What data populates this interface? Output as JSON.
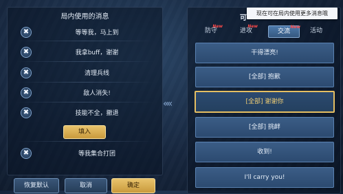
{
  "left_panel": {
    "title": "局内使用的消息",
    "messages": [
      {
        "label": "等等我，马上到",
        "remove_icon": "close-icon"
      },
      {
        "label": "我拿buff，谢谢",
        "remove_icon": "close-icon"
      },
      {
        "label": "清理兵线",
        "remove_icon": "close-icon"
      },
      {
        "label": "敌人消失!",
        "remove_icon": "close-icon"
      },
      {
        "label": "技能不全，撤退",
        "remove_icon": "close-icon"
      },
      {
        "label": "等我集合打团",
        "remove_icon": "close-icon"
      }
    ],
    "fill_button": "填入",
    "remove_glyph": "✖"
  },
  "transfer_arrows": "«",
  "bottom_buttons": {
    "restore_default": "恢复默认",
    "cancel": "取消",
    "confirm": "确定"
  },
  "right_panel": {
    "title_partial": "可",
    "tooltip": "现在可在局内使用更多消息哦",
    "tabs": [
      {
        "label": "防守",
        "new": "New",
        "active": false
      },
      {
        "label": "进攻",
        "new": "New",
        "active": false
      },
      {
        "label": "交流",
        "new": "New",
        "active": true
      },
      {
        "label": "活动",
        "new": "",
        "active": false
      }
    ],
    "cards": [
      {
        "label": "干得漂亮!",
        "selected": false
      },
      {
        "label": "[全部] 抱歉",
        "selected": false
      },
      {
        "label": "[全部] 谢谢你",
        "selected": true
      },
      {
        "label": "[全部] 挑衅",
        "selected": false
      },
      {
        "label": "收到!",
        "selected": false
      },
      {
        "label": "I'll carry you!",
        "selected": false
      }
    ]
  },
  "colors": {
    "accent_gold": "#e6bf62",
    "new_tag": "#ff4a4a",
    "card_blue": "#2c4a70"
  }
}
